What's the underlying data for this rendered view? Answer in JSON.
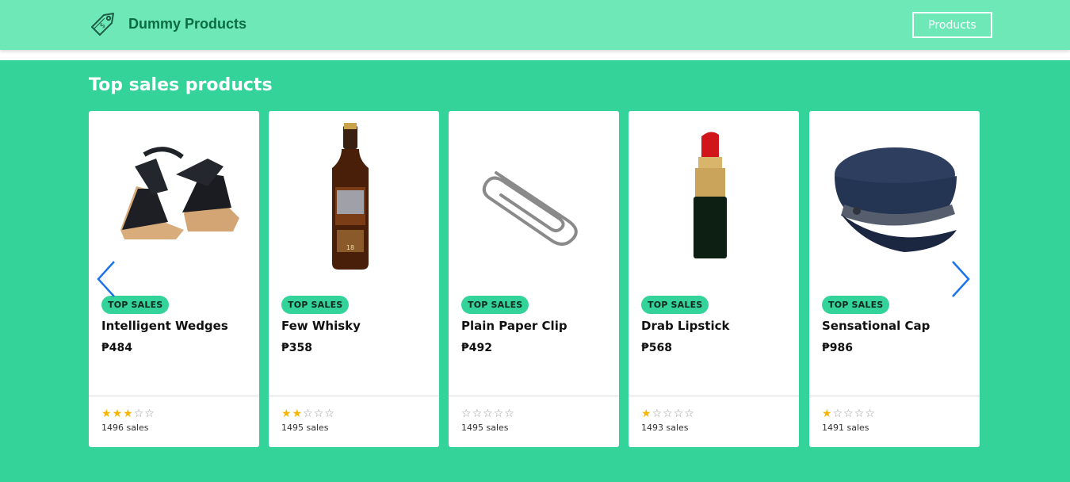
{
  "navbar": {
    "brand_name": "Dummy Products",
    "products_button": "Products"
  },
  "section": {
    "title": "Top sales products"
  },
  "colors": {
    "navbar_bg": "#6fe8b8",
    "section_bg": "#34d399",
    "badge_bg": "#34d399",
    "star_filled": "#f7b500",
    "arrow": "#1a73e8"
  },
  "carousel": {
    "prev_icon": "chevron-left-icon",
    "next_icon": "chevron-right-icon"
  },
  "products": [
    {
      "badge": "TOP SALES",
      "name": "Intelligent Wedges",
      "price": "₱484",
      "rating": 3,
      "rating_max": 5,
      "sales": "1496 sales",
      "image": "wedge-sandal"
    },
    {
      "badge": "TOP SALES",
      "name": "Few Whisky",
      "price": "₱358",
      "rating": 2,
      "rating_max": 5,
      "sales": "1495 sales",
      "image": "whisky-bottle"
    },
    {
      "badge": "TOP SALES",
      "name": "Plain Paper Clip",
      "price": "₱492",
      "rating": 0,
      "rating_max": 5,
      "sales": "1495 sales",
      "image": "paper-clip"
    },
    {
      "badge": "TOP SALES",
      "name": "Drab Lipstick",
      "price": "₱568",
      "rating": 1,
      "rating_max": 5,
      "sales": "1493 sales",
      "image": "lipstick"
    },
    {
      "badge": "TOP SALES",
      "name": "Sensational Cap",
      "price": "₱986",
      "rating": 1,
      "rating_max": 5,
      "sales": "1491 sales",
      "image": "sailor-cap"
    }
  ]
}
